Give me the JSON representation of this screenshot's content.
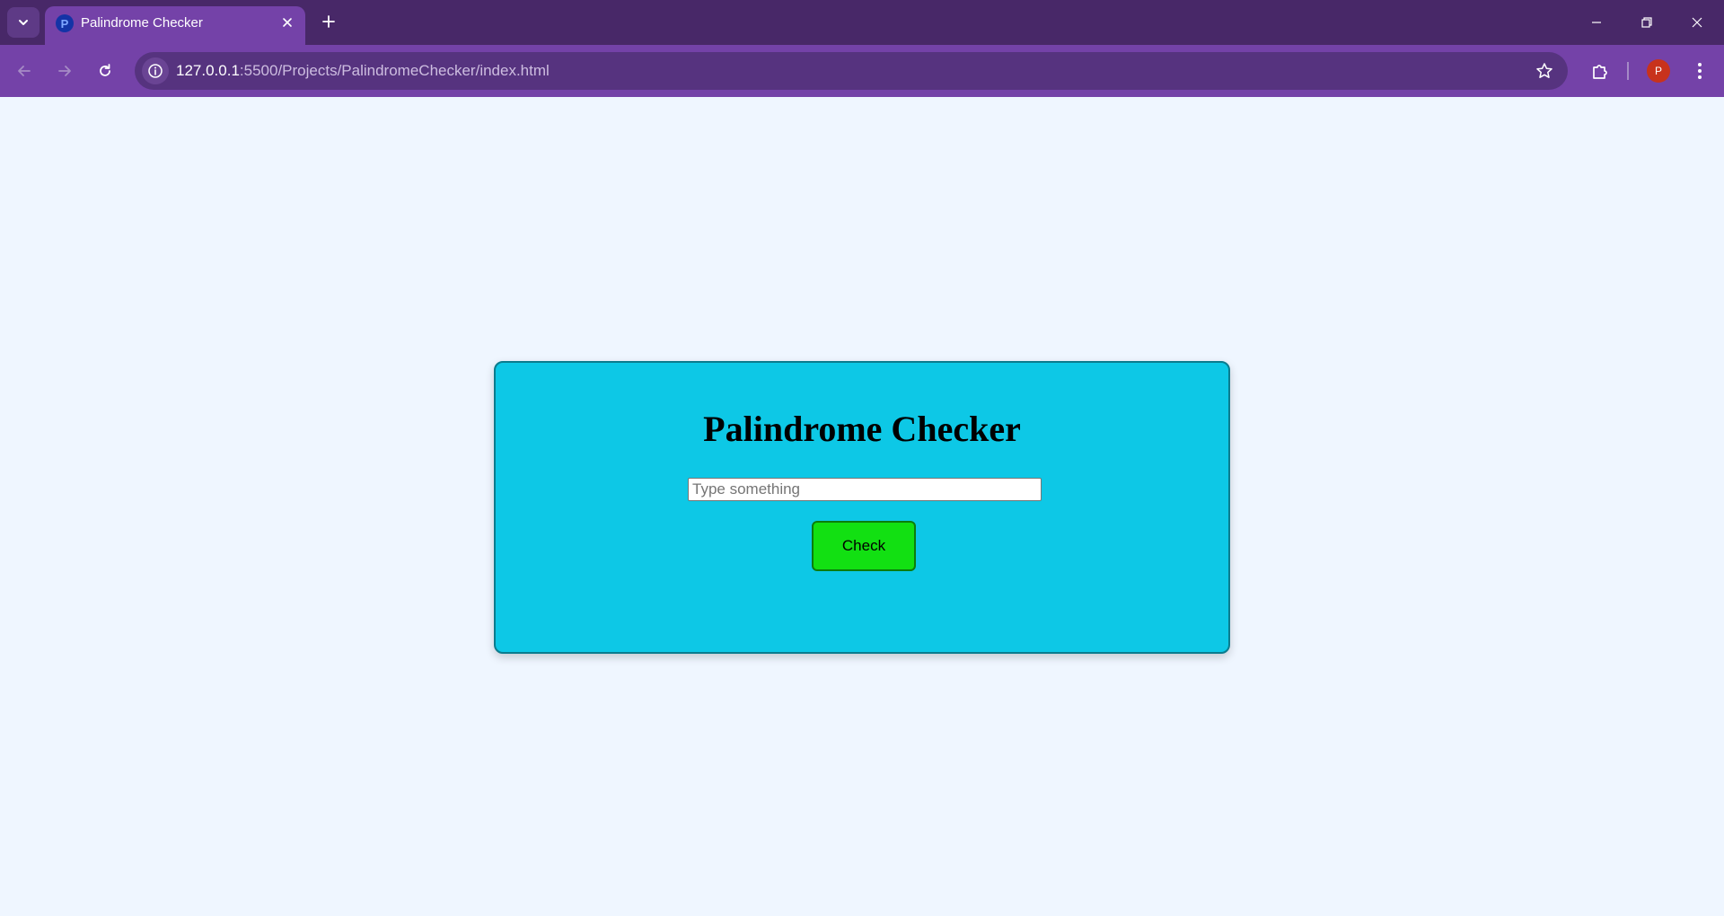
{
  "browser": {
    "tab": {
      "favicon_letter": "P",
      "title": "Palindrome Checker"
    },
    "url": {
      "host": "127.0.0.1",
      "path": ":5500/Projects/PalindromeChecker/index.html"
    },
    "profile_initial": "P",
    "colors": {
      "frame": "#482868",
      "toolbar": "#7442a8",
      "omnibox": "#56337f",
      "avatar": "#c8321c"
    }
  },
  "page": {
    "heading": "Palindrome Checker",
    "input": {
      "value": "",
      "placeholder": "Type something"
    },
    "check_button_label": "Check",
    "colors": {
      "background": "#eff6ff",
      "card": "#0dc8e6",
      "button": "#12e012"
    }
  }
}
